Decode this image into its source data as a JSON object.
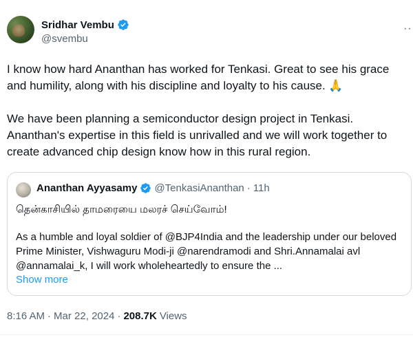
{
  "tweet": {
    "author": {
      "display_name": "Sridhar Vembu",
      "handle": "@svembu"
    },
    "more_menu_glyph": "···",
    "body": "I know how hard Ananthan has worked for Tenkasi. Great to see his grace and humility, along with his discipline and loyalty to his cause. 🙏\n\nWe have been planning a semiconductor design project in Tenkasi. Ananthan's expertise in this field is unrivalled and we will work together to create advanced chip design know how in this rural region.",
    "quoted": {
      "display_name": "Ananthan Ayyasamy",
      "handle": "@TenkasiAnanthan",
      "separator": "·",
      "time": "11h",
      "tamil_line": "தென்காசியில் தாமரையை மலரச் செய்வோம்!",
      "text": "As a humble and loyal soldier of @BJP4India and the leadership under our beloved Prime Minister, Vishwaguru Modi-ji @narendramodi and Shri.Annamalai avl @annamalai_k, I will work wholeheartedly to ensure the ...",
      "show_more": "Show more"
    },
    "meta": {
      "time": "8:16 AM",
      "dot1": "·",
      "date": "Mar 22, 2024",
      "dot2": "·",
      "views_count": "208.7K",
      "views_label": "Views"
    }
  },
  "colors": {
    "text_primary": "#0f1419",
    "text_secondary": "#536471",
    "link": "#1d9bf0",
    "verified": "#1d9bf0",
    "border": "#cfd9de"
  }
}
